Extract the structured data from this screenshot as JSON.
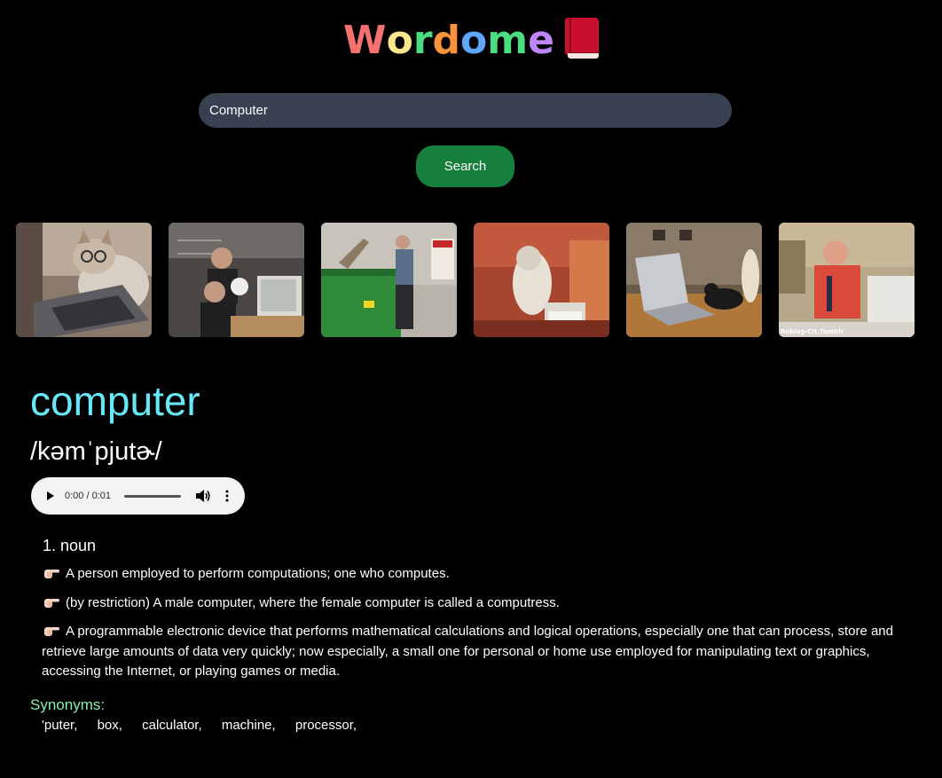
{
  "app": {
    "logo_letters": [
      "W",
      "o",
      "r",
      "d",
      "o",
      "m",
      "e"
    ],
    "logo_letter_colors": [
      "#f87171",
      "#fde68a",
      "#4ade80",
      "#fb923c",
      "#60a5fa",
      "#4ade80",
      "#c084fc"
    ],
    "logo_icon": "red-book-icon"
  },
  "search": {
    "value": "Computer",
    "button_label": "Search"
  },
  "gallery": {
    "images": [
      {
        "alt": "cat with glasses typing on laptop"
      },
      {
        "alt": "men wrestling a computer monitor"
      },
      {
        "alt": "man throwing computer into dumpster"
      },
      {
        "alt": "monkey typing on computer keyboard"
      },
      {
        "alt": "cat pushing a laptop"
      },
      {
        "alt": "man scratching head at computer"
      }
    ],
    "watermark": "Roblog-Cit.Tumblr"
  },
  "entry": {
    "word": "computer",
    "phonetic": "/kəmˈpjutɚ/",
    "audio": {
      "time": "0:00 / 0:01"
    },
    "part_of_speech": "1. noun",
    "definitions": [
      "A person employed to perform computations; one who computes.",
      "(by restriction) A male computer, where the female computer is called a computress.",
      "A programmable electronic device that performs mathematical calculations and logical operations, especially one that can process, store and retrieve large amounts of data very quickly; now especially, a small one for personal or home use employed for manipulating text or graphics, accessing the Internet, or playing games or media."
    ],
    "definition_icon": "pointing-hand-icon",
    "synonyms_heading": "Synonyms:",
    "synonyms": [
      "'puter,",
      "box,",
      "calculator,",
      "machine,",
      "processor,"
    ]
  },
  "colors": {
    "background": "#000000",
    "headword": "#67e8f9",
    "synonyms_heading": "#86efac",
    "search_field": "#374151",
    "search_button": "#15803d"
  }
}
